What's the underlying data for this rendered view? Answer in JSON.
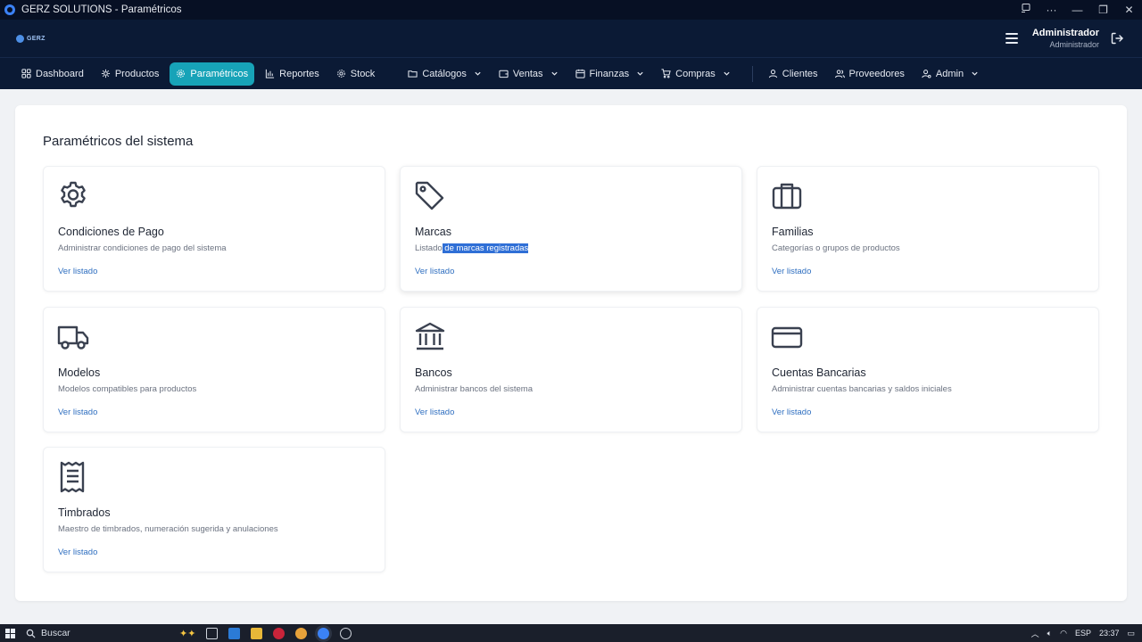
{
  "window": {
    "title": "GERZ SOLUTIONS - Paramétricos"
  },
  "header": {
    "logo_text": "GERZ",
    "user_name": "Administrador",
    "user_role": "Administrador"
  },
  "nav": {
    "items": [
      {
        "label": "Dashboard",
        "icon": "dashboard-icon"
      },
      {
        "label": "Productos",
        "icon": "box-icon"
      },
      {
        "label": "Paramétricos",
        "icon": "gear-icon",
        "active": true
      },
      {
        "label": "Reportes",
        "icon": "bar-chart-icon"
      },
      {
        "label": "Stock",
        "icon": "cog-icon"
      },
      {
        "label": "Catálogos",
        "icon": "folder-icon",
        "dropdown": true
      },
      {
        "label": "Ventas",
        "icon": "wallet-icon",
        "dropdown": true
      },
      {
        "label": "Finanzas",
        "icon": "calendar-icon",
        "dropdown": true
      },
      {
        "label": "Compras",
        "icon": "cart-icon",
        "dropdown": true
      },
      {
        "label": "Clientes",
        "icon": "user-icon"
      },
      {
        "label": "Proveedores",
        "icon": "users-icon"
      },
      {
        "label": "Admin",
        "icon": "admin-icon",
        "dropdown": true
      }
    ],
    "accent_color": "#17a3b8"
  },
  "main": {
    "title": "Paramétricos del sistema",
    "link_label": "Ver listado",
    "cards": [
      {
        "title": "Condiciones de Pago",
        "description": "Administrar condiciones de pago del sistema",
        "icon": "gear-icon"
      },
      {
        "title": "Marcas",
        "description_before": "Listado",
        "description_selected": " de marcas registradas",
        "icon": "tag-icon"
      },
      {
        "title": "Familias",
        "description": "Categorías o grupos de productos",
        "icon": "briefcase-icon"
      },
      {
        "title": "Modelos",
        "description": "Modelos compatibles para productos",
        "icon": "truck-icon"
      },
      {
        "title": "Bancos",
        "description": "Administrar bancos del sistema",
        "icon": "bank-icon"
      },
      {
        "title": "Cuentas Bancarias",
        "description": "Administrar cuentas bancarias y saldos iniciales",
        "icon": "credit-card-icon"
      },
      {
        "title": "Timbrados",
        "description": "Maestro de timbrados, numeración sugerida y anulaciones",
        "icon": "receipt-icon"
      }
    ]
  },
  "taskbar": {
    "search_placeholder": "Buscar",
    "language": "ESP",
    "time": "23:37"
  }
}
